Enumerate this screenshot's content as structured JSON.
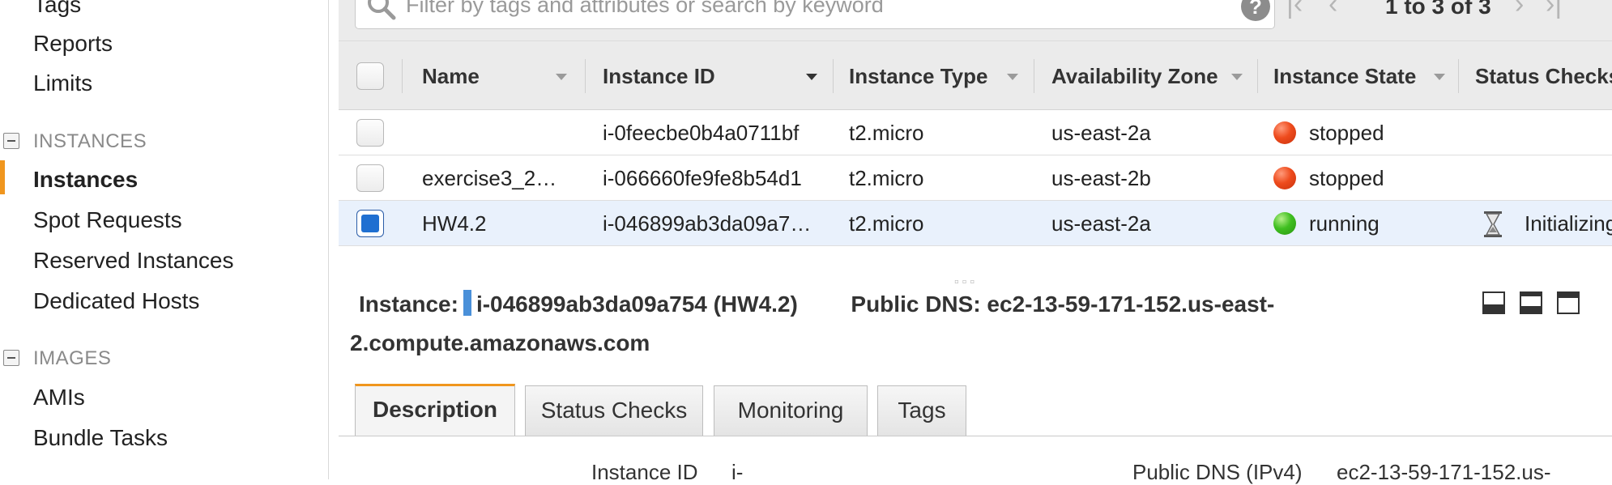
{
  "sidebar": {
    "items_top": [
      {
        "label": "Tags"
      },
      {
        "label": "Reports"
      },
      {
        "label": "Limits"
      }
    ],
    "instances_section": {
      "header": "INSTANCES",
      "items": [
        {
          "label": "Instances"
        },
        {
          "label": "Spot Requests"
        },
        {
          "label": "Reserved Instances"
        },
        {
          "label": "Dedicated Hosts"
        }
      ]
    },
    "images_section": {
      "header": "IMAGES",
      "items": [
        {
          "label": "AMIs"
        },
        {
          "label": "Bundle Tasks"
        }
      ]
    },
    "accent_color": "#f0961e"
  },
  "toolbar": {
    "search_placeholder": "Filter by tags and attributes or search by keyword",
    "help_glyph": "?",
    "pager_text": "1 to 3 of 3"
  },
  "table": {
    "columns": [
      "Name",
      "Instance ID",
      "Instance Type",
      "Availability Zone",
      "Instance State",
      "Status Checks"
    ],
    "rows": [
      {
        "name": "",
        "instance_id": "i-0feecbe0b4a0711bf",
        "type": "t2.micro",
        "zone": "us-east-2a",
        "state": "stopped",
        "status_checks": "",
        "selected": false
      },
      {
        "name": "exercise3_2…",
        "instance_id": "i-066660fe9fe8b54d1",
        "type": "t2.micro",
        "zone": "us-east-2b",
        "state": "stopped",
        "status_checks": "",
        "selected": false
      },
      {
        "name": "HW4.2",
        "instance_id": "i-046899ab3da09a7…",
        "type": "t2.micro",
        "zone": "us-east-2a",
        "state": "running",
        "status_checks": "Initializing",
        "selected": true
      }
    ],
    "state_colors": {
      "stopped": "#ee4b1d",
      "running": "#3fbf20"
    }
  },
  "detail": {
    "instance_label": "Instance:",
    "instance_value": "i-046899ab3da09a754 (HW4.2)",
    "dns_label": "Public DNS:",
    "dns_value_part1": "ec2-13-59-171-152.us-east-",
    "dns_value_part2": "2.compute.amazonaws.com",
    "tabs": [
      "Description",
      "Status Checks",
      "Monitoring",
      "Tags"
    ],
    "active_tab": "Description",
    "fields": {
      "instance_id_label": "Instance ID",
      "instance_id_value": "i-",
      "public_dns_label": "Public DNS (IPv4)",
      "public_dns_value": "ec2-13-59-171-152.us-"
    }
  }
}
